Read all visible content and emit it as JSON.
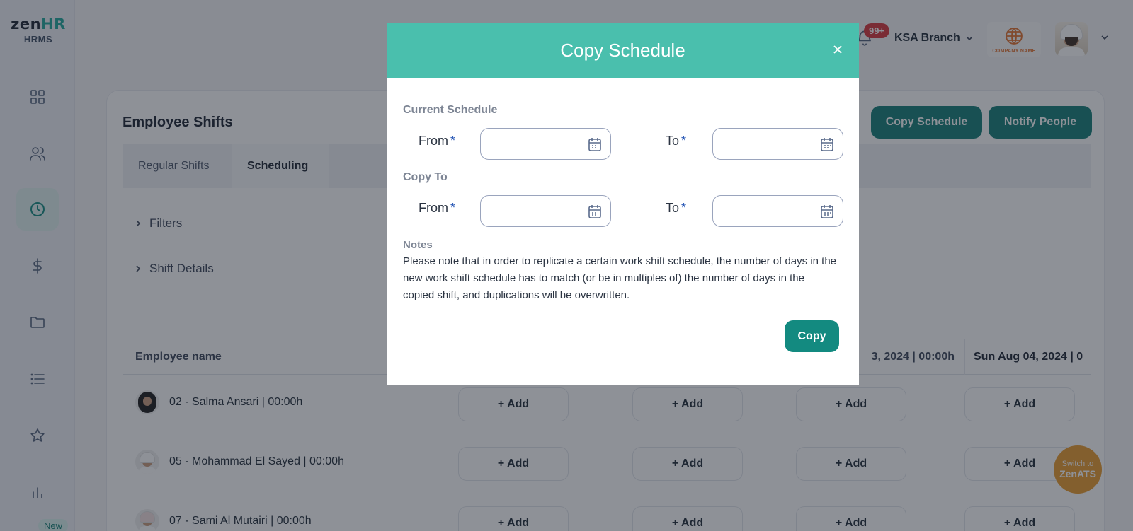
{
  "brand": {
    "name_part1": "zen",
    "name_part2": "HR",
    "subtitle": "HRMS"
  },
  "sidebar": {
    "new_badge": "New"
  },
  "topbar": {
    "notification_count": "99+",
    "branch": "KSA Branch",
    "company_logo_text": "COMPANY NAME"
  },
  "page": {
    "title": "Employee Shifts",
    "buttons": {
      "copy_schedule": "Copy Schedule",
      "notify_people": "Notify People"
    },
    "tabs": [
      {
        "label": "Regular Shifts"
      },
      {
        "label": "Scheduling"
      }
    ],
    "filters": "Filters",
    "shift_details": "Shift Details",
    "table": {
      "headers": {
        "employee": "Employee name",
        "date3": "3, 2024 | 00:00h",
        "date4": "Sun Aug 04, 2024 | 0"
      },
      "add_label": "+ Add",
      "rows": [
        {
          "name": "02 - Salma Ansari | 00:00h"
        },
        {
          "name": "05 - Mohammad El Sayed | 00:00h"
        },
        {
          "name": "07 - Sami Al Mutairi | 00:00h"
        }
      ]
    },
    "switch_ats": {
      "line1": "Switch to",
      "line2": "ZenATS"
    }
  },
  "modal": {
    "title": "Copy Schedule",
    "current_schedule": "Current Schedule",
    "copy_to": "Copy To",
    "from_label": "From",
    "to_label": "To",
    "required_mark": "*",
    "notes_label": "Notes",
    "notes_text": "Please note that in order to replicate a certain work shift schedule, the number of days in the new work shift schedule has to match (or be in multiples of) the number of days in the copied shift, and duplications will be overwritten.",
    "copy_button": "Copy"
  },
  "colors": {
    "accent": "#127d77",
    "modal_header": "#4abfad",
    "notification": "#d6353b",
    "switch_ats": "#e89a2c"
  }
}
